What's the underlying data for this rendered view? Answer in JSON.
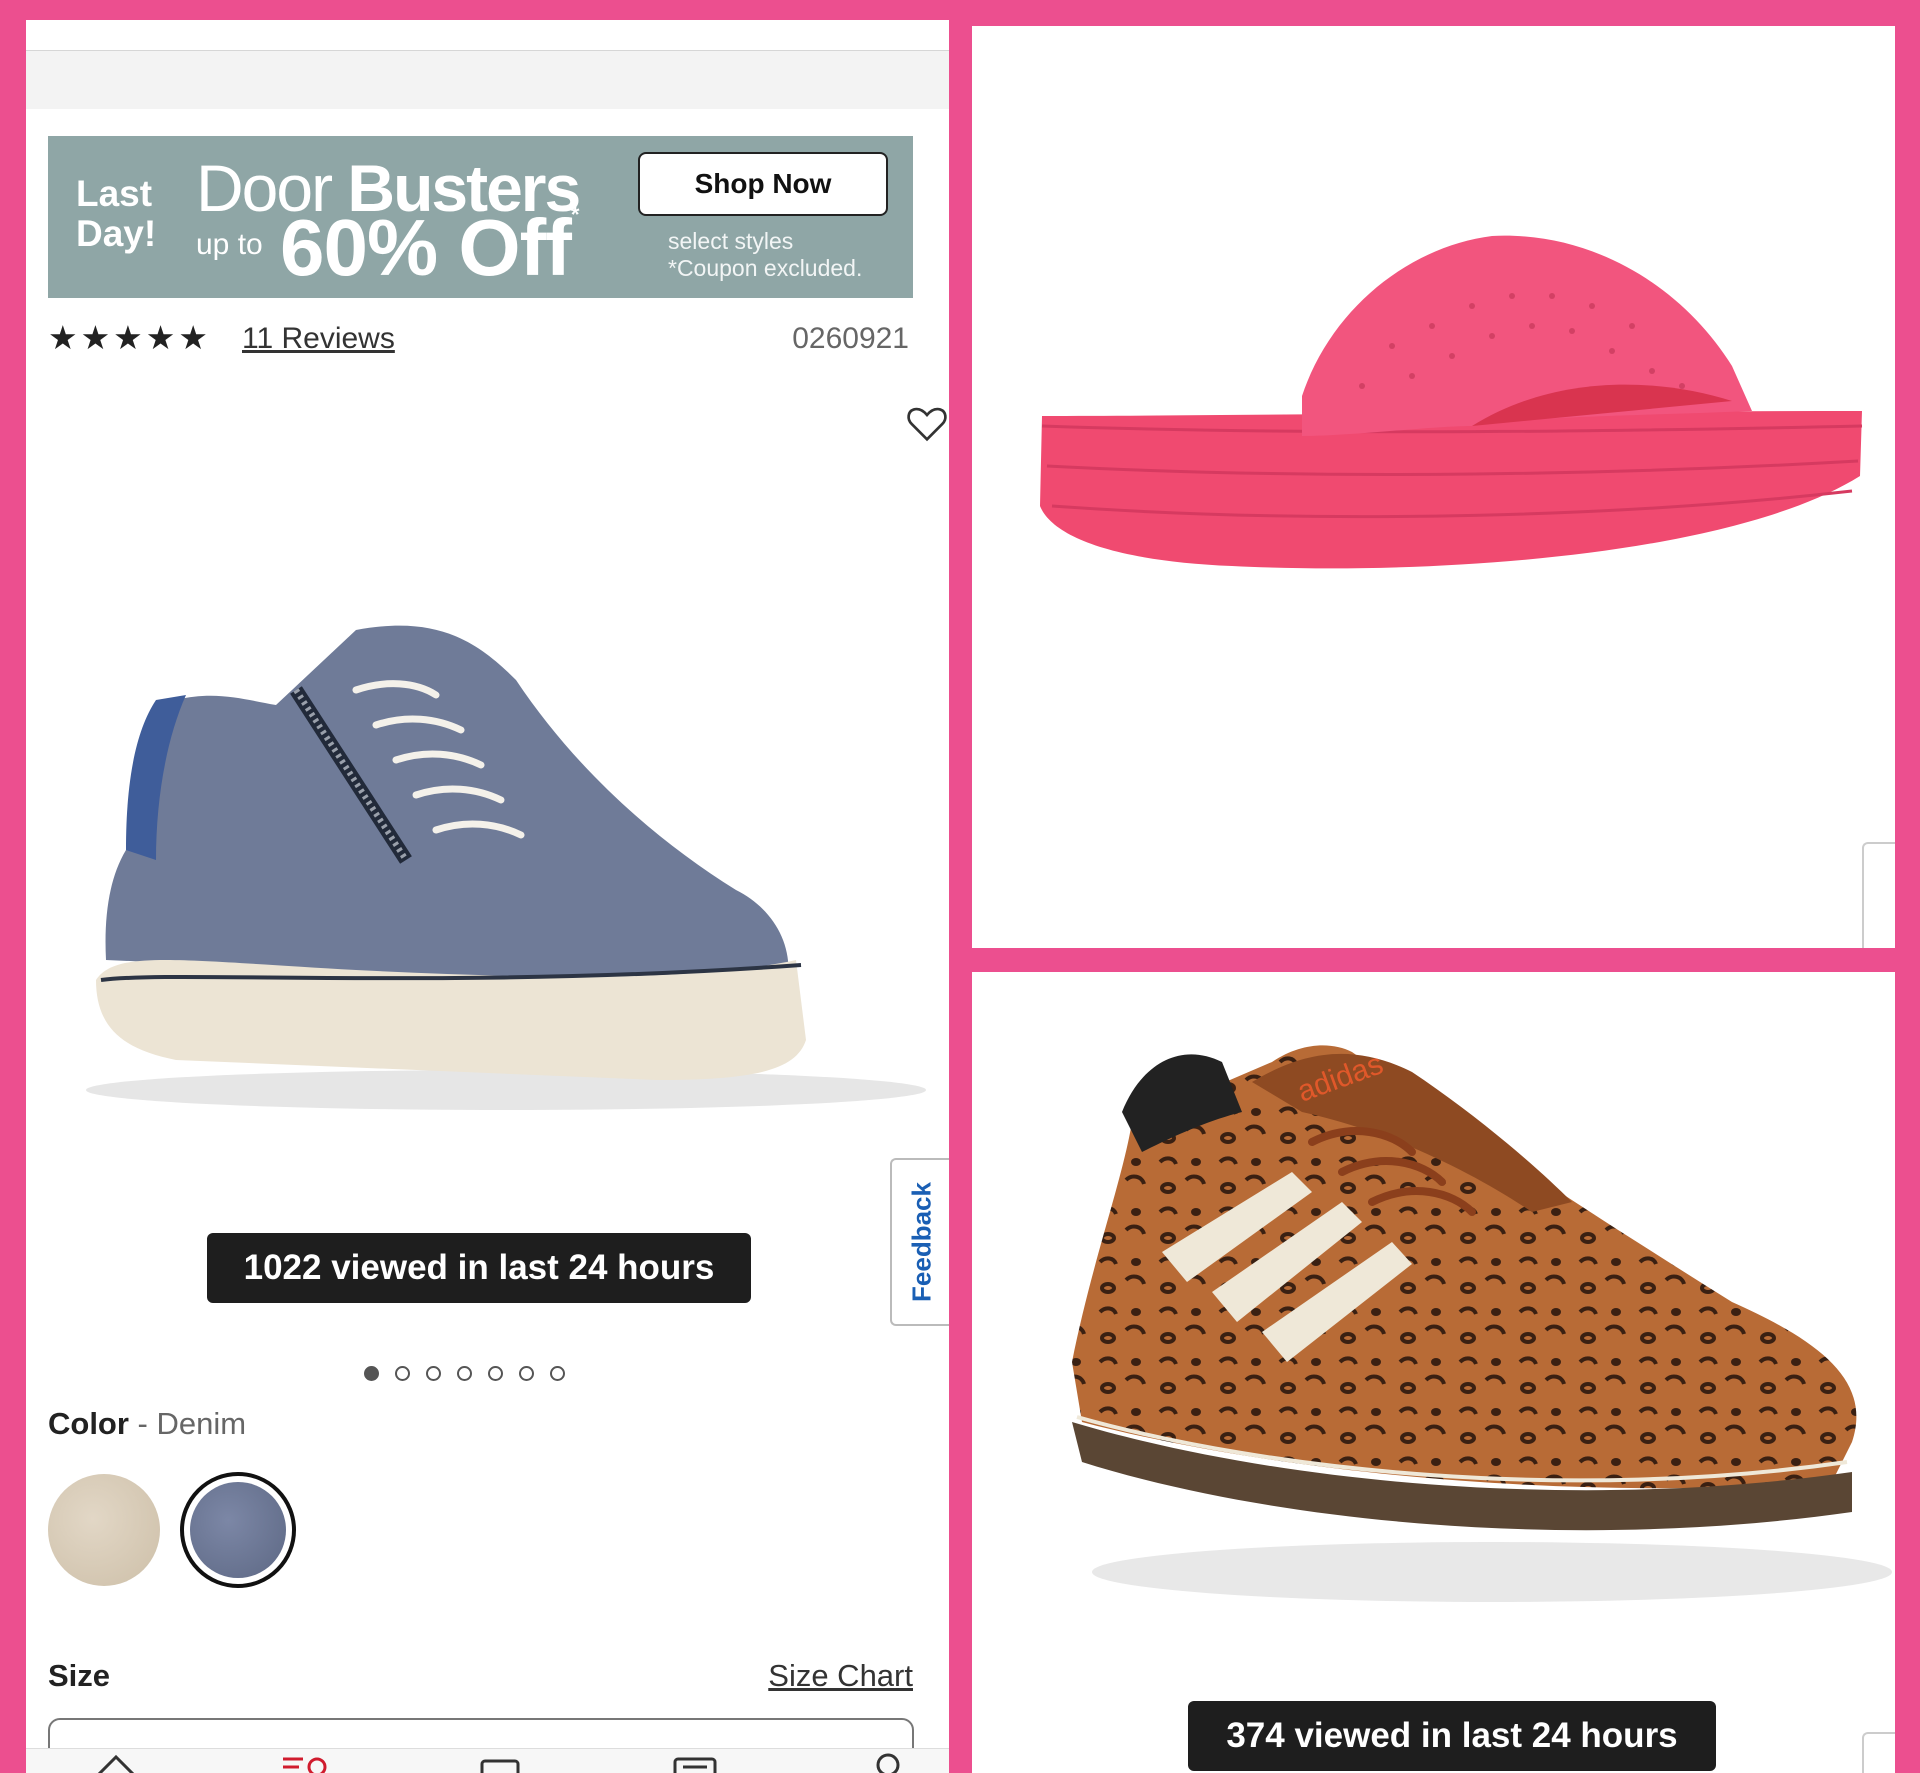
{
  "promo": {
    "last_day": "Last Day!",
    "door": "Door",
    "busters": "Busters",
    "up_to": "up to",
    "discount": "60% Off",
    "asterisk": "*",
    "shop_now": "Shop Now",
    "note_line1": "select styles",
    "note_line2": "*Coupon excluded."
  },
  "product": {
    "stars": "★★★★★",
    "rating": 4.5,
    "reviews": "11 Reviews",
    "sku": "0260921",
    "viewed": "1022 viewed in last 24 hours",
    "carousel": {
      "total": 7,
      "active": 1
    },
    "color_label": "Color",
    "color_separator": " - ",
    "color_value": "Denim",
    "size_label": "Size",
    "size_chart": "Size Chart",
    "feedback": "Feedback"
  },
  "bottom_right": {
    "viewed": "374 viewed in last 24 hours",
    "logo_text": "adidas"
  },
  "colors": {
    "background": "#ec4f8f",
    "promo": "#8fa6a6",
    "sandal": "#f2557e",
    "denim": "#6f7b98"
  },
  "icons": [
    "heart-icon",
    "home-icon",
    "menu-icon",
    "wallet-icon",
    "account-icon",
    "search-icon"
  ]
}
